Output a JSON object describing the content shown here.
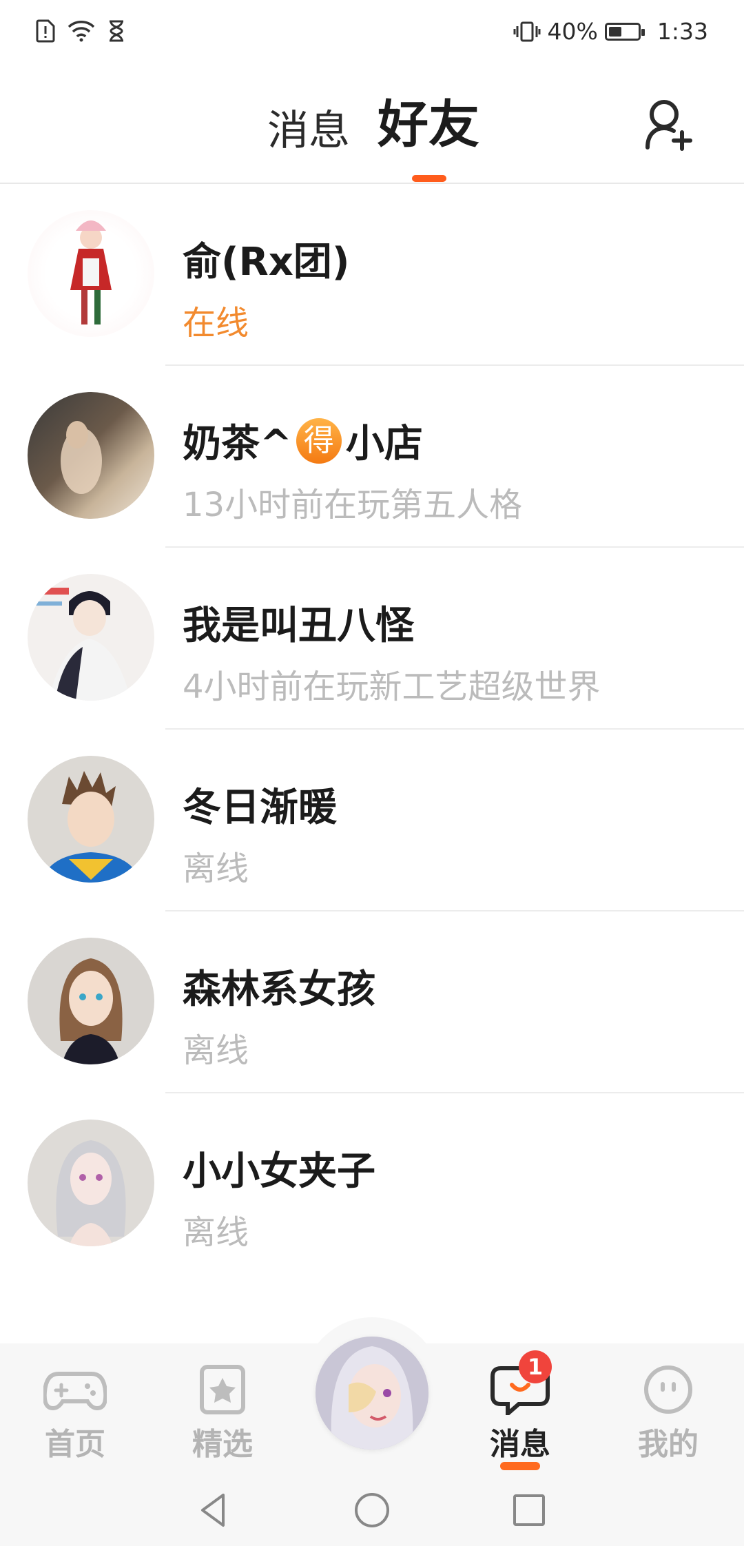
{
  "status_bar": {
    "battery_percent": "40%",
    "battery_level": 0.4,
    "time": "1:33",
    "icons": [
      "sim-alert-icon",
      "wifi-icon",
      "hourglass-icon",
      "vibrate-icon",
      "battery-icon"
    ]
  },
  "header": {
    "tabs": [
      {
        "label": "消息",
        "active": false
      },
      {
        "label": "好友",
        "active": true
      }
    ],
    "add_friend_icon": "add-friend-icon"
  },
  "friends": [
    {
      "name": "俞(Rx团)",
      "status": "在线",
      "online": true
    },
    {
      "name_before": "奶茶^",
      "name_badge": "得",
      "name_after": "小店",
      "status": "13小时前在玩第五人格",
      "online": false
    },
    {
      "name": "我是叫丑八怪",
      "status": "4小时前在玩新工艺超级世界",
      "online": false
    },
    {
      "name": "冬日渐暖",
      "status": "离线",
      "online": false
    },
    {
      "name": "森林系女孩",
      "status": "离线",
      "online": false
    },
    {
      "name": "小小女夹子",
      "status": "离线",
      "online": false
    }
  ],
  "bottom_nav": {
    "items": [
      {
        "label": "首页",
        "icon": "gamepad-icon",
        "active": false
      },
      {
        "label": "精选",
        "icon": "star-card-icon",
        "active": false
      },
      {
        "label": "消息",
        "icon": "chat-bubble-icon",
        "active": true,
        "badge": "1"
      },
      {
        "label": "我的",
        "icon": "face-icon",
        "active": false
      }
    ],
    "center": "avatar"
  },
  "colors": {
    "accent": "#ff5c1c",
    "online": "#f28a2e",
    "badge": "#f0443c"
  }
}
